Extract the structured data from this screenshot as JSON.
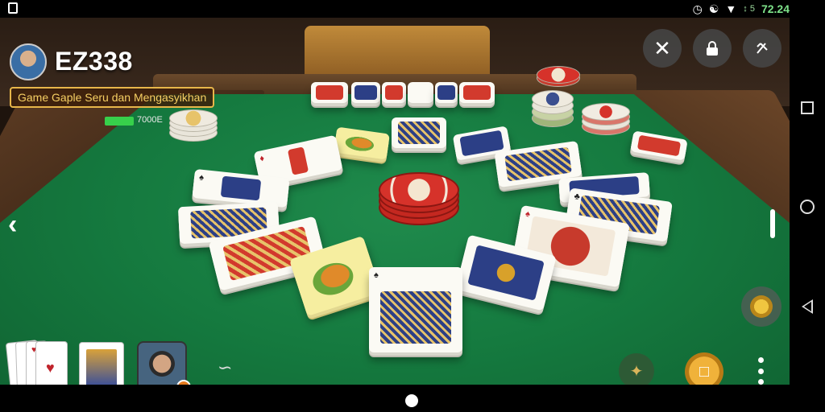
{
  "status_bar": {
    "time": "72.24",
    "network": "↕ 5"
  },
  "hud": {
    "title": "EZ338",
    "subtitle": "Game Gaple Seru dan Mengasyikhan",
    "battery_label": "7000E"
  },
  "colors": {
    "felt": "#157a3f",
    "wood_rail": "#5a3a22",
    "subtitle_text": "#f6cf63",
    "subtitle_border": "#e7b64a",
    "chip_red": "#c42820",
    "tile_navy": "#2c3f86",
    "battery": "#37d04b",
    "accent_gold": "#f0b23a"
  },
  "icons": {
    "close": "close-icon",
    "lock": "lock-icon",
    "settings": "tools-icon",
    "back_arrow": "chevron-left-icon",
    "gesture": "hand-gesture-icon",
    "emblem": "emblem-icon",
    "deck": "deck-icon",
    "coin": "coin-icon",
    "more": "more-vertical-icon"
  },
  "game": {
    "hand_cards": [
      "cards-fan",
      "joker-card"
    ]
  }
}
